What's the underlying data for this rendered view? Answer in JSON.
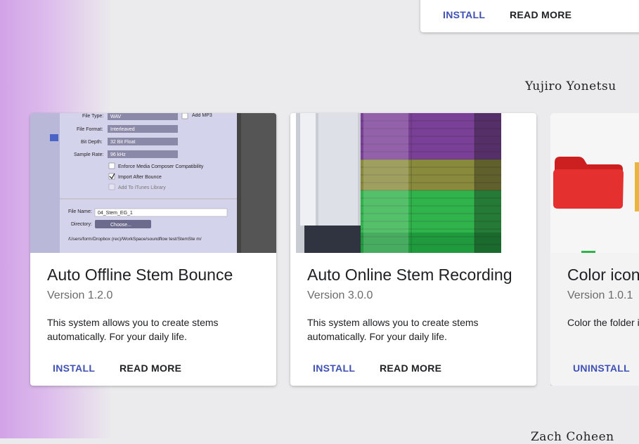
{
  "top_card": {
    "install_label": "INSTALL",
    "read_more_label": "READ MORE"
  },
  "section_header": "Yujiro Yonetsu",
  "next_section_header": "Zach Coheen",
  "cards": [
    {
      "title": "Auto Offline Stem Bounce",
      "version": "Version 1.2.0",
      "description": "This system allows you to create stems automatically. For your daily life.",
      "primary_action": "INSTALL",
      "secondary_action": "READ MORE",
      "image_text": {
        "file_type_label": "File Type:",
        "file_type_value": "WAV",
        "add_mp3": "Add MP3",
        "file_format_label": "File Format:",
        "file_format_value": "Interleaved",
        "bit_depth_label": "Bit Depth:",
        "bit_depth_value": "32 Bit Float",
        "sample_rate_label": "Sample Rate:",
        "sample_rate_value": "96 kHz",
        "opt1": "Enforce Media Composer Compatibility",
        "opt2": "Import After Bounce",
        "opt3": "Add To iTunes Library",
        "file_name_label": "File Name:",
        "file_name_value": "04_Stem_EG_1",
        "directory_label": "Directory:",
        "choose_button": "Choose...",
        "path": "/Users/form/Dropbox (rec)/WorkSpace/soundflow test/StemSte m/"
      }
    },
    {
      "title": "Auto Online Stem Recording",
      "version": "Version 3.0.0",
      "description": "This system allows you to create stems automatically. For your daily life.",
      "primary_action": "INSTALL",
      "secondary_action": "READ MORE"
    },
    {
      "title": "Color icon",
      "version": "Version 1.0.1",
      "description": "Color the folder i",
      "primary_action": "UNINSTALL"
    }
  ],
  "colors": {
    "primary": "#3f51b5",
    "text": "#202124",
    "muted": "#6b6b6b",
    "background": "#ebebed"
  }
}
